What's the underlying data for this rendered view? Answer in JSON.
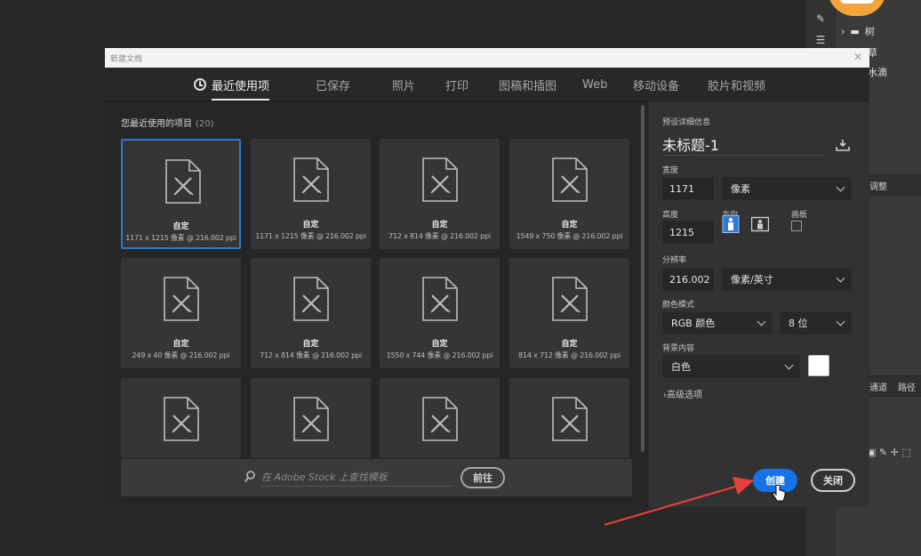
{
  "background_panel": {
    "layers": [
      "树",
      "草",
      "水滴"
    ],
    "panel_tabs": [
      "调整",
      "通道",
      "路径"
    ]
  },
  "dialog": {
    "title": "新建文档",
    "tabs": [
      {
        "label": "最近使用项",
        "active": true
      },
      {
        "label": "已保存"
      },
      {
        "label": "照片"
      },
      {
        "label": "打印"
      },
      {
        "label": "图稿和插图"
      },
      {
        "label": "Web"
      },
      {
        "label": "移动设备"
      },
      {
        "label": "胶片和视频"
      }
    ],
    "recent": {
      "label": "您最近使用的项目",
      "count": "(20)",
      "items": [
        {
          "name": "自定",
          "info": "1171 x 1215 像素 @ 216.002 ppi",
          "selected": true
        },
        {
          "name": "自定",
          "info": "1171 x 1215 像素 @ 216.002 ppi"
        },
        {
          "name": "自定",
          "info": "712 x 814 像素 @ 216.002 ppi"
        },
        {
          "name": "自定",
          "info": "1549 x 750 像素 @ 216.002 ppi"
        },
        {
          "name": "自定",
          "info": "249 x 40 像素 @ 216.002 ppi"
        },
        {
          "name": "自定",
          "info": "712 x 814 像素 @ 216.002 ppi"
        },
        {
          "name": "自定",
          "info": "1550 x 744 像素 @ 216.002 ppi"
        },
        {
          "name": "自定",
          "info": "814 x 712 像素 @ 216.002 ppi"
        }
      ]
    },
    "stock": {
      "placeholder": "在 Adobe Stock 上查找模板",
      "go_label": "前往"
    },
    "preset_details": {
      "section_label": "预设详细信息",
      "doc_name": "未标题-1",
      "width_label": "宽度",
      "width_value": "1171",
      "width_unit": "像素",
      "height_label": "高度",
      "height_value": "1215",
      "orientation_label": "方向",
      "artboard_label": "画板",
      "resolution_label": "分辨率",
      "resolution_value": "216.002",
      "resolution_unit": "像素/英寸",
      "color_mode_label": "颜色模式",
      "color_mode_value": "RGB 颜色",
      "bit_depth_value": "8 位",
      "background_label": "背景内容",
      "background_value": "白色",
      "background_color": "#ffffff",
      "advanced_label": "高级选项"
    },
    "buttons": {
      "create": "创建",
      "close": "关闭"
    }
  },
  "colors": {
    "accent": "#1473e6",
    "selection": "#2d79d3",
    "annotation_arrow": "#e8403a"
  }
}
